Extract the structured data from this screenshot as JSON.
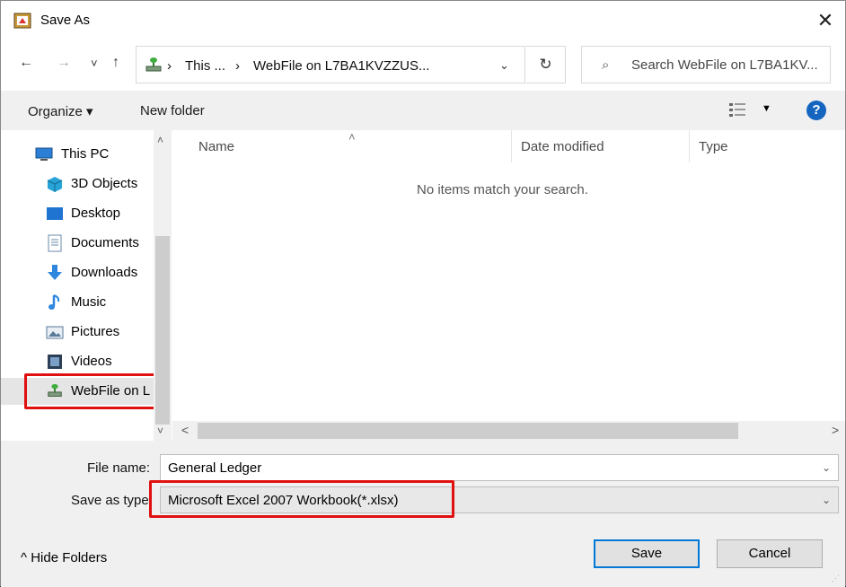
{
  "title": "Save As",
  "close_glyph": "✕",
  "nav": {
    "back": "←",
    "forward": "→",
    "recent": "˅",
    "up": "↑",
    "address_parts": [
      "This ...",
      "WebFile on L7BA1KVZZUS..."
    ],
    "separator": "›",
    "address_dropdown": "⌄",
    "refresh": "↻",
    "search_placeholder": "Search WebFile on L7BA1KV..."
  },
  "toolbar": {
    "organize_label": "Organize ▾",
    "new_folder_label": "New folder",
    "view_dropdown": "▼",
    "help_label": "?"
  },
  "sidebar": {
    "items": [
      {
        "label": "This PC",
        "icon": "this-pc-icon"
      },
      {
        "label": "3D Objects",
        "icon": "3d-objects-icon"
      },
      {
        "label": "Desktop",
        "icon": "desktop-icon"
      },
      {
        "label": "Documents",
        "icon": "documents-icon"
      },
      {
        "label": "Downloads",
        "icon": "downloads-icon"
      },
      {
        "label": "Music",
        "icon": "music-icon"
      },
      {
        "label": "Pictures",
        "icon": "pictures-icon"
      },
      {
        "label": "Videos",
        "icon": "videos-icon"
      },
      {
        "label": "WebFile on L",
        "icon": "network-drive-icon"
      }
    ],
    "scroll_up": "˄",
    "scroll_down": "˅"
  },
  "files": {
    "columns": [
      "Name",
      "Date modified",
      "Type"
    ],
    "sort_caret": "˄",
    "empty_message": "No items match your search.",
    "scroll_left": "<",
    "scroll_right": ">"
  },
  "form": {
    "file_name_label": "File name:",
    "file_name_value": "General Ledger",
    "save_type_label": "Save as type:",
    "save_type_value": "Microsoft Excel 2007 Workbook(*.xlsx)",
    "dropdown_arrow": "⌄"
  },
  "buttons": {
    "hide_folders": "^  Hide Folders",
    "save": "Save",
    "cancel": "Cancel"
  },
  "colors": {
    "highlight": "#e01010",
    "accent": "#0078d7",
    "help": "#1565c0"
  }
}
